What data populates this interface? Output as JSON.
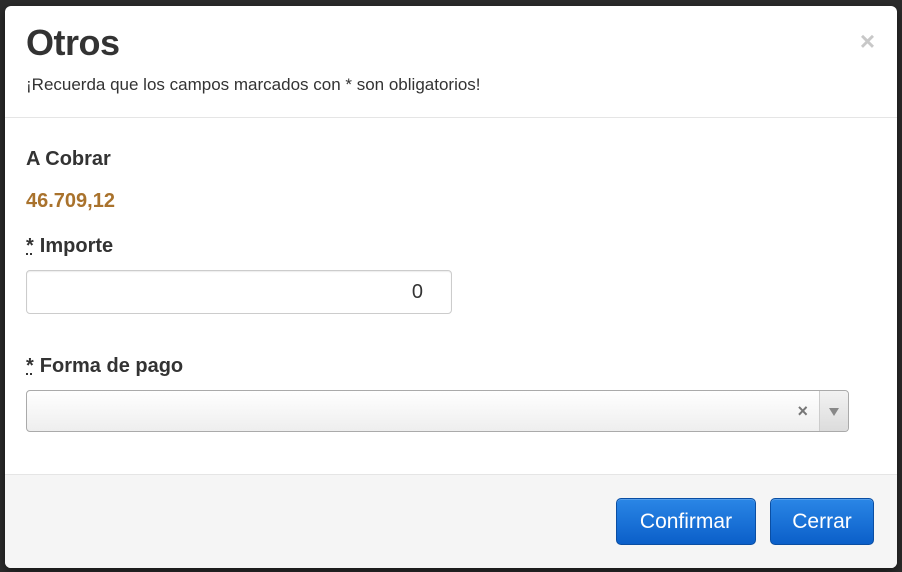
{
  "modal": {
    "title": "Otros",
    "subtitle": "¡Recuerda que los campos marcados con * son obligatorios!",
    "close_icon": "×"
  },
  "form": {
    "cobrar_label": "A Cobrar",
    "cobrar_value": "46.709,12",
    "required_mark": "*",
    "importe_label": "Importe",
    "importe_value": "0",
    "forma_pago_label": "Forma de pago",
    "forma_pago_value": "",
    "clear_icon": "×"
  },
  "footer": {
    "confirm_label": "Confirmar",
    "close_label": "Cerrar"
  },
  "colors": {
    "amount": "#a9722c",
    "button": "#0b5fc9"
  }
}
